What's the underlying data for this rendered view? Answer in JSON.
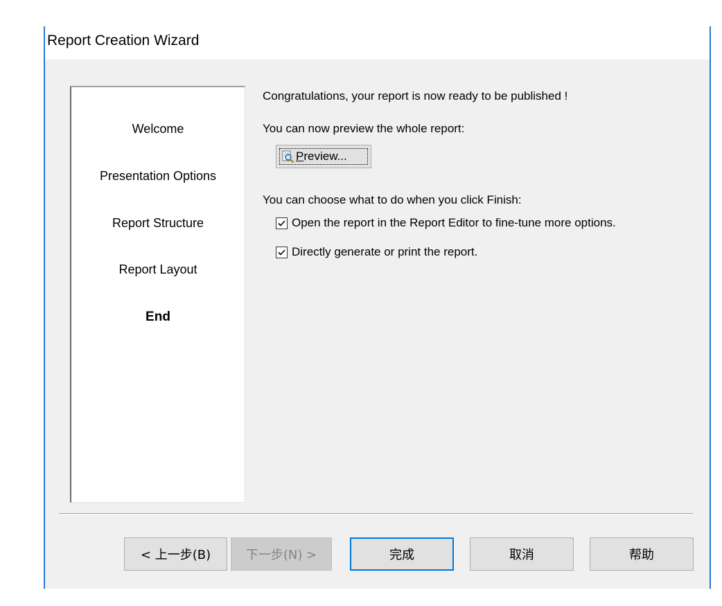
{
  "window": {
    "title": "Report Creation Wizard"
  },
  "steps": [
    {
      "label": "Welcome",
      "current": false
    },
    {
      "label": "Presentation Options",
      "current": false
    },
    {
      "label": "Report Structure",
      "current": false
    },
    {
      "label": "Report Layout",
      "current": false
    },
    {
      "label": "End",
      "current": true
    }
  ],
  "content": {
    "congrats": "Congratulations, your report is now ready to be published !",
    "preview_intro": "You can now preview the whole report:",
    "preview_button": {
      "accel": "P",
      "rest": "review...",
      "icon": "magnifier-document-icon"
    },
    "finish_intro": "You can choose what to do when you click Finish:",
    "options": [
      {
        "label": "Open the report in the Report Editor to fine-tune more options.",
        "checked": true
      },
      {
        "label": "Directly generate or print the report.",
        "checked": true
      }
    ]
  },
  "buttons": {
    "back": "< 上一步(B)",
    "next": "下一步(N) >",
    "finish": "完成",
    "cancel": "取消",
    "help": "帮助"
  },
  "colors": {
    "dialog_border": "#2b78d4",
    "client_bg": "#f0f0f0",
    "button_bg": "#e1e1e1",
    "default_button_border": "#0078d7",
    "disabled_text": "#838383"
  }
}
